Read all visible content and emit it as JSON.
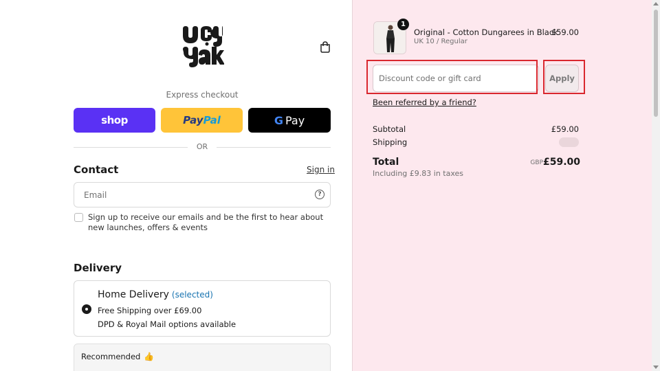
{
  "brand": {
    "name": "Lucy & Yak"
  },
  "header": {
    "cart_icon": "shopping-bag-icon"
  },
  "express": {
    "label": "Express checkout",
    "shop_label": "shop",
    "paypal_part1": "Pay",
    "paypal_part2": "Pal",
    "gpay_g": "G",
    "gpay_label": "Pay",
    "or_label": "OR"
  },
  "contact": {
    "title": "Contact",
    "signin_label": "Sign in",
    "email_placeholder": "Email",
    "help_icon": "question-circle-icon",
    "newsletter_text": "Sign up to receive our emails and be the first to hear about new launches, offers & events",
    "newsletter_checked": false
  },
  "delivery": {
    "title": "Delivery",
    "option_name": "Home Delivery",
    "option_state": "(selected)",
    "line1": "Free Shipping over £69.00",
    "line2": "DPD & Royal Mail options available",
    "recommended_label": "Recommended",
    "recommended_icon": "thumbs-up-icon"
  },
  "order": {
    "product": {
      "quantity": "1",
      "name": "Original - Cotton Dungarees in Black",
      "variant": "UK 10 / Regular",
      "price": "£59.00"
    },
    "discount_placeholder": "Discount code or gift card",
    "apply_label": "Apply",
    "referred_label": "Been referred by a friend?",
    "subtotal_label": "Subtotal",
    "subtotal_value": "£59.00",
    "shipping_label": "Shipping",
    "total_label": "Total",
    "currency": "GBP",
    "total_value": "£59.00",
    "tax_note": "Including £9.83 in taxes"
  },
  "colors": {
    "shop_pay": "#5a31f4",
    "paypal": "#ffc439",
    "summary_bg": "#fde8ee",
    "highlight": "#d9272e",
    "link_blue": "#1773b0"
  }
}
